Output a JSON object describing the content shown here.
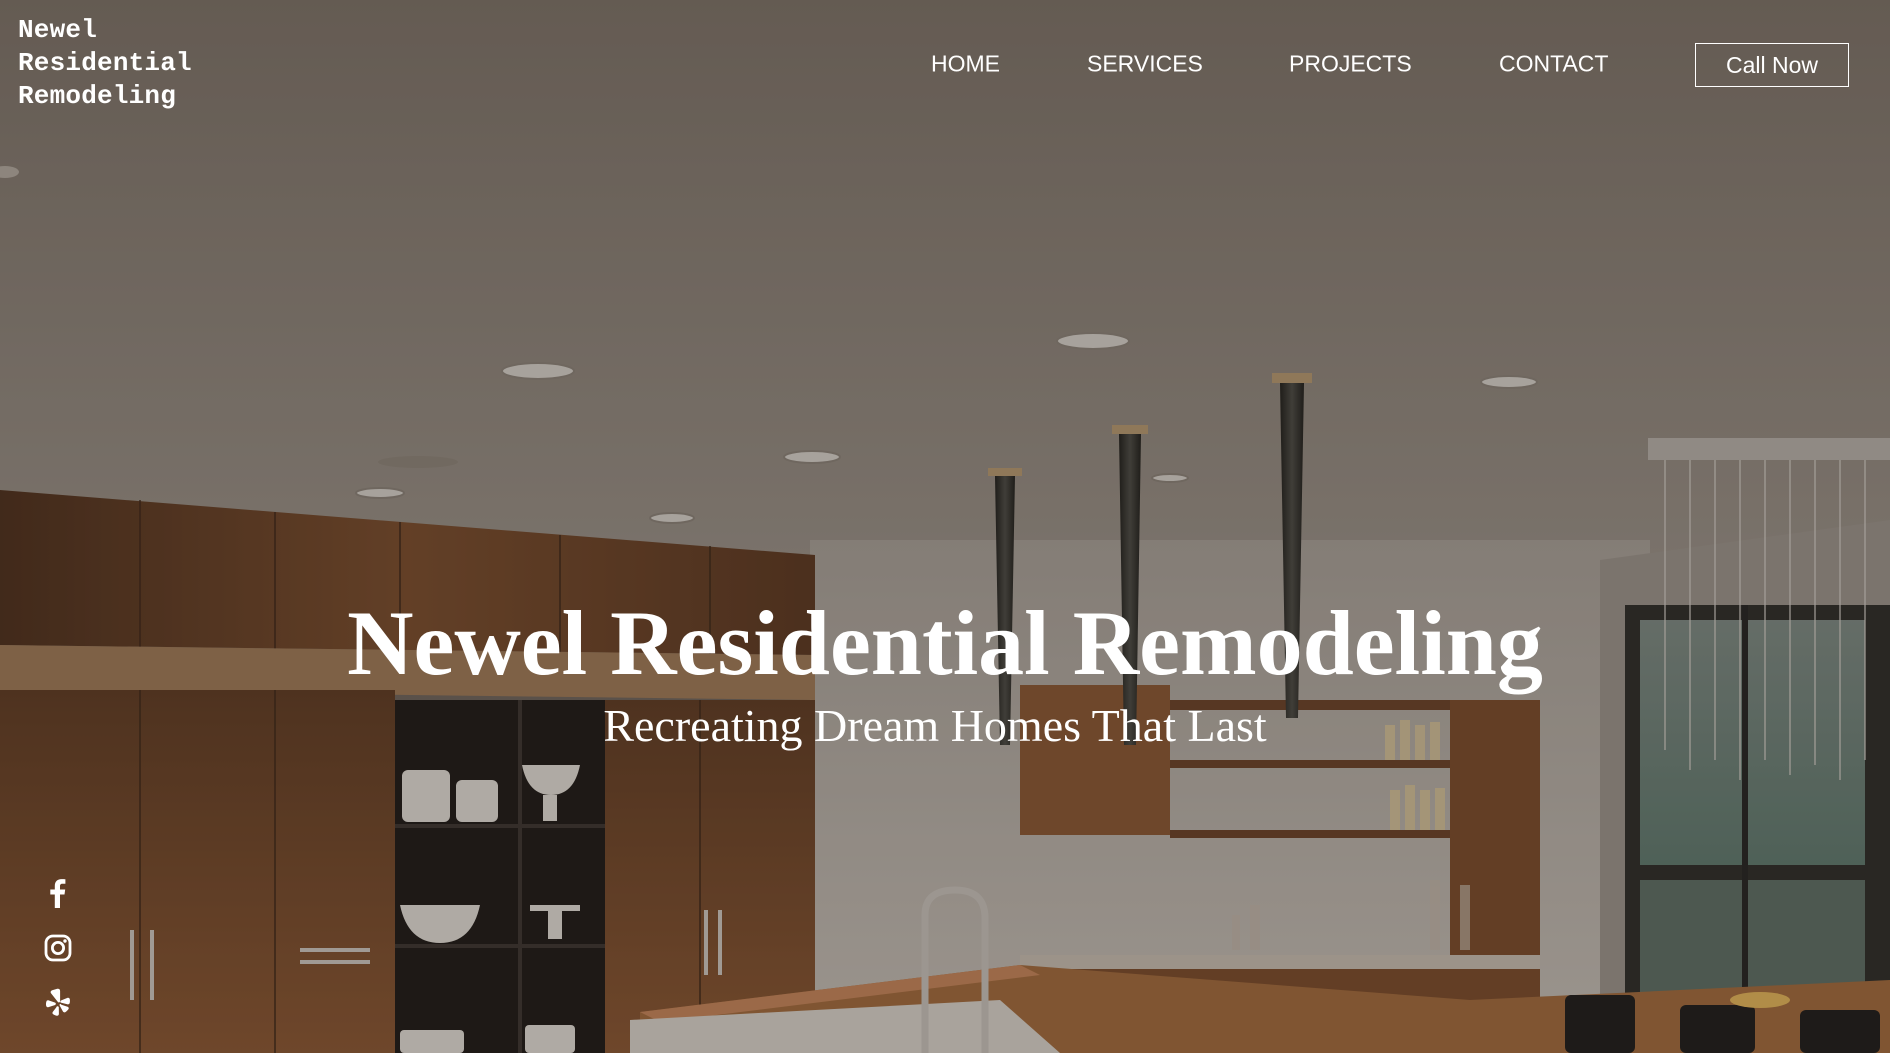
{
  "brand": {
    "logo_lines": [
      "Newel",
      "Residential",
      "Remodeling"
    ]
  },
  "nav": {
    "items": [
      {
        "label": "HOME"
      },
      {
        "label": "SERVICES"
      },
      {
        "label": "PROJECTS"
      },
      {
        "label": "CONTACT"
      }
    ],
    "cta_label": "Call Now"
  },
  "hero": {
    "title": "Newel Residential Remodeling",
    "subtitle": "Recreating Dream Homes That Last",
    "background": "kitchen-interior-photo"
  },
  "social": {
    "icons": [
      "facebook-icon",
      "instagram-icon",
      "yelp-icon"
    ]
  },
  "colors": {
    "text": "#ffffff",
    "overlay": "#28201a",
    "wood": "#7a4a2a",
    "ceiling": "#8a827a"
  }
}
